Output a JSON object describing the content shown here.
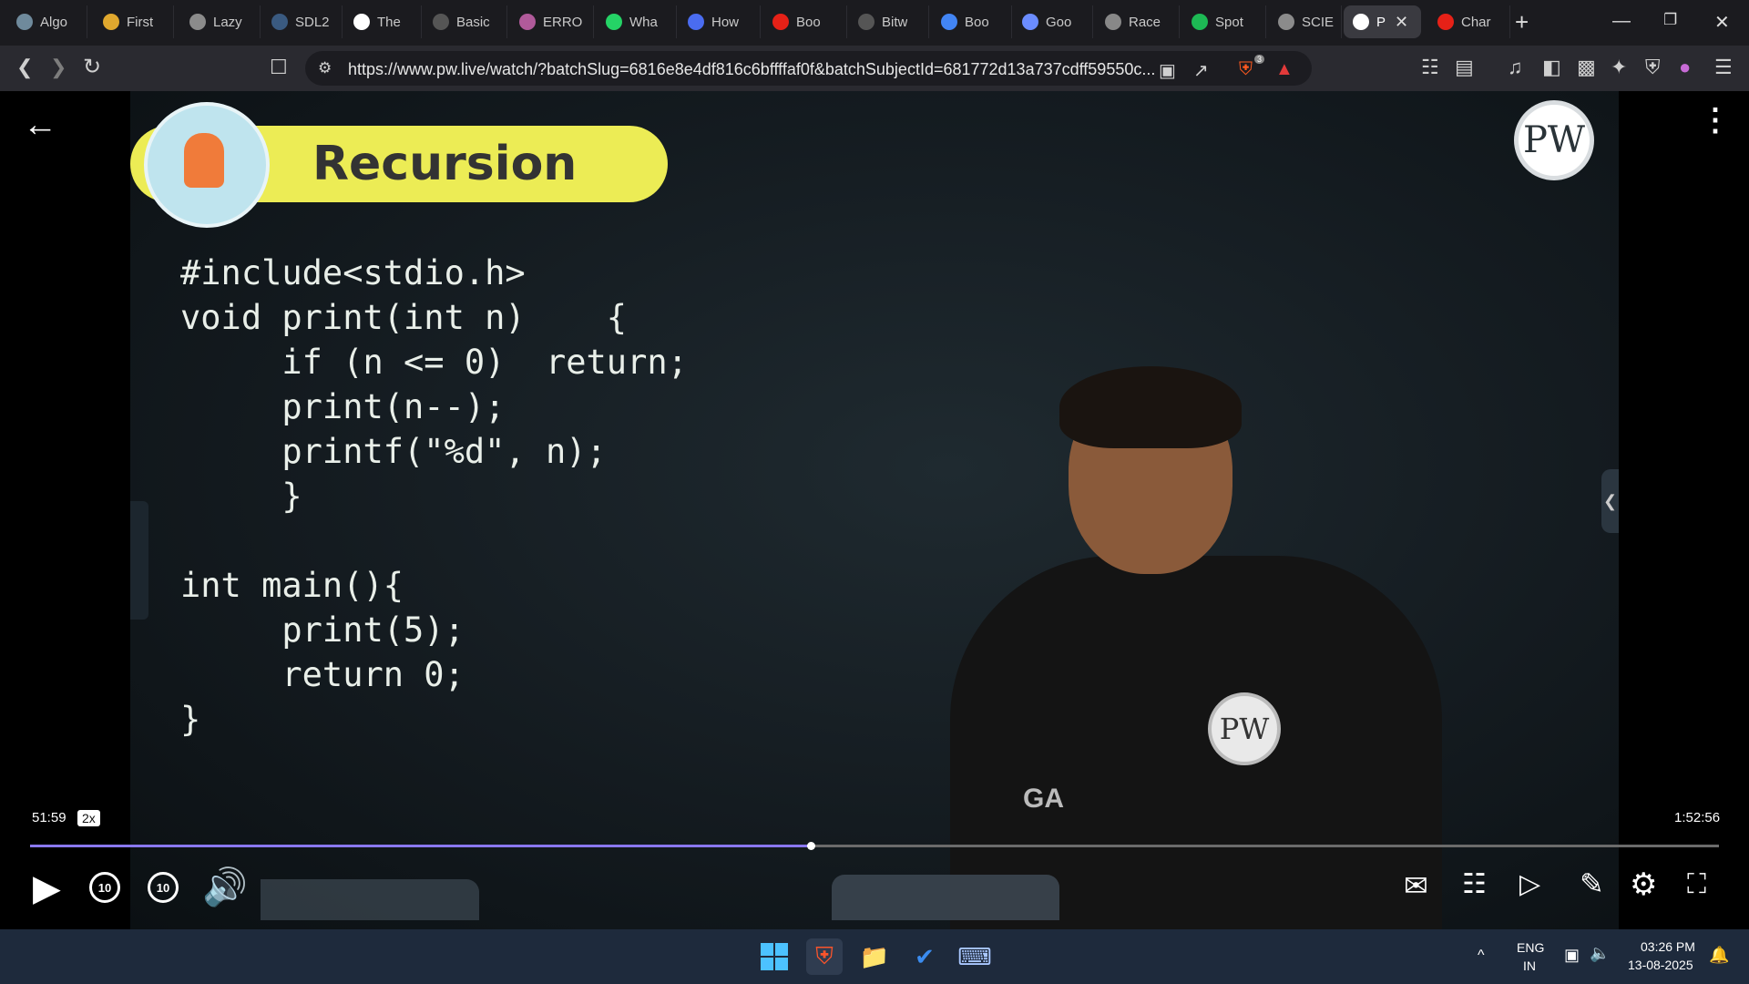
{
  "browser": {
    "tabs": [
      {
        "label": "Algo",
        "icon": "globe-icon",
        "color": "#6f8a9c"
      },
      {
        "label": "First",
        "icon": "first-icon",
        "color": "#e0a82e"
      },
      {
        "label": "Lazy",
        "icon": "globe-icon",
        "color": "#8b8b8b"
      },
      {
        "label": "SDL2",
        "icon": "sdl-icon",
        "color": "#3a5a80"
      },
      {
        "label": "The",
        "icon": "w3-icon",
        "color": "#ffffff"
      },
      {
        "label": "Basic",
        "icon": "site-icon",
        "color": "#555555"
      },
      {
        "label": "ERRO",
        "icon": "profile-icon",
        "color": "#b05a9a"
      },
      {
        "label": "Wha",
        "icon": "whatsapp-icon",
        "color": "#25d366"
      },
      {
        "label": "How",
        "icon": "bookmark-icon",
        "color": "#4a6cf0"
      },
      {
        "label": "Boo",
        "icon": "youtube-icon",
        "color": "#e62117"
      },
      {
        "label": "Bitw",
        "icon": "site-icon",
        "color": "#555555"
      },
      {
        "label": "Boo",
        "icon": "google-icon",
        "color": "#4285f4"
      },
      {
        "label": "Goo",
        "icon": "gemini-icon",
        "color": "#6b8cff"
      },
      {
        "label": "Race",
        "icon": "openai-icon",
        "color": "#888888"
      },
      {
        "label": "Spot",
        "icon": "spotify-icon",
        "color": "#1db954"
      },
      {
        "label": "SCIE",
        "icon": "globe-icon",
        "color": "#8b8b8b"
      },
      {
        "label": "P",
        "icon": "speaker-icon",
        "color": "#ffffff",
        "active": true
      },
      {
        "label": "Char",
        "icon": "youtube-icon",
        "color": "#e62117"
      }
    ],
    "url": "https://www.pw.live/watch/?batchSlug=6816e8e4df816c6bffffaf0f&batchSubjectId=681772d13a737cdff59550c...",
    "shield_count": "3"
  },
  "video": {
    "title": "Recursion",
    "logo_text": "PW",
    "code_lines": [
      "#include<stdio.h>",
      "void print(int n)    {",
      "     if (n <= 0)  return;",
      "     print(n--);",
      "     printf(\"%d\", n);",
      "     }",
      "",
      "int main(){",
      "     print(5);",
      "     return 0;",
      "}"
    ],
    "shirt_text": "GA"
  },
  "player": {
    "current_time": "51:59",
    "speed": "2x",
    "total_time": "1:52:56",
    "progress_fraction": 0.4625,
    "rewind_label": "10",
    "forward_label": "10",
    "accent_color": "#8a78f0"
  },
  "taskbar": {
    "lang_line1": "ENG",
    "lang_line2": "IN",
    "time": "03:26 PM",
    "date": "13-08-2025"
  }
}
